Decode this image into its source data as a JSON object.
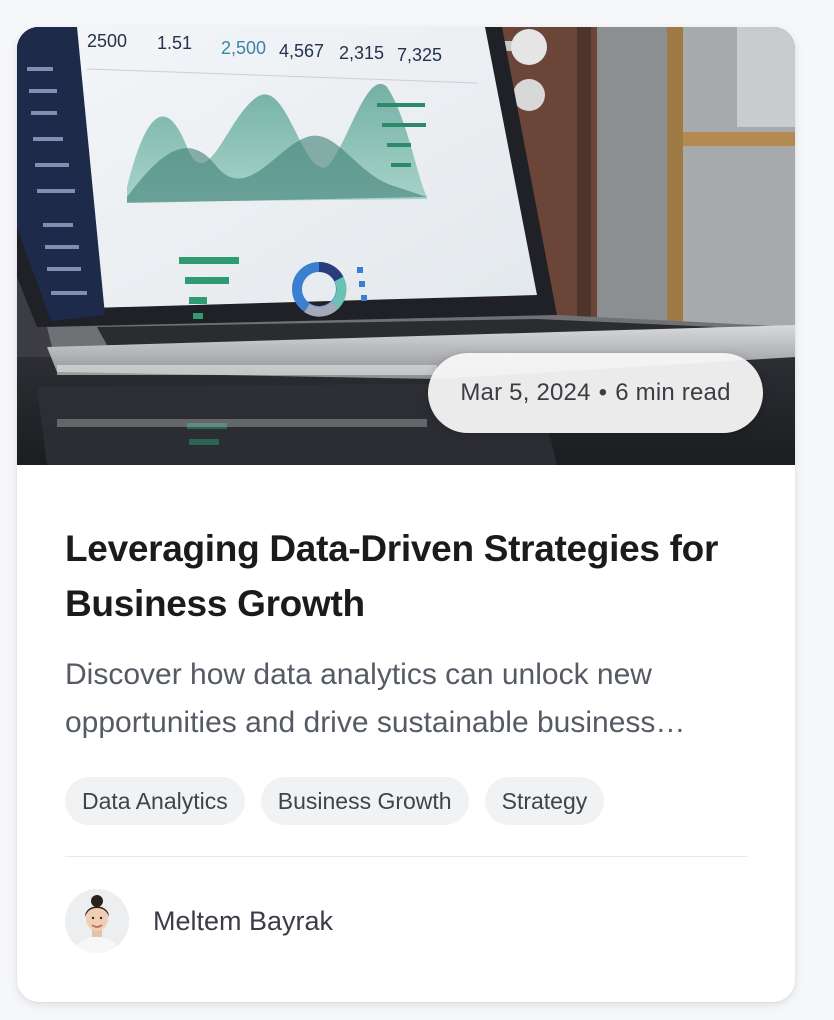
{
  "card": {
    "meta": {
      "date": "Mar 5, 2024",
      "separator": "•",
      "read_time": "6 min read"
    },
    "title": "Leveraging Data-Driven Strategies for Business Growth",
    "excerpt": "Discover how data analytics can unlock new opportunities and drive sustainable business growth.",
    "tags": [
      {
        "label": "Data Analytics"
      },
      {
        "label": "Business Growth"
      },
      {
        "label": "Strategy"
      }
    ],
    "author": {
      "name": "Meltem Bayrak",
      "avatar_icon": "avatar-photo"
    },
    "hero_image": {
      "screen_stats": [
        "2500",
        "1.51",
        "2,500",
        "4,567",
        "2,315",
        "7,325"
      ]
    }
  },
  "colors": {
    "title": "#1d1a1a",
    "excerpt": "#555a64",
    "tag_bg": "#f1f2f4",
    "card_bg": "#ffffff",
    "page_bg": "#f6f7f9"
  }
}
